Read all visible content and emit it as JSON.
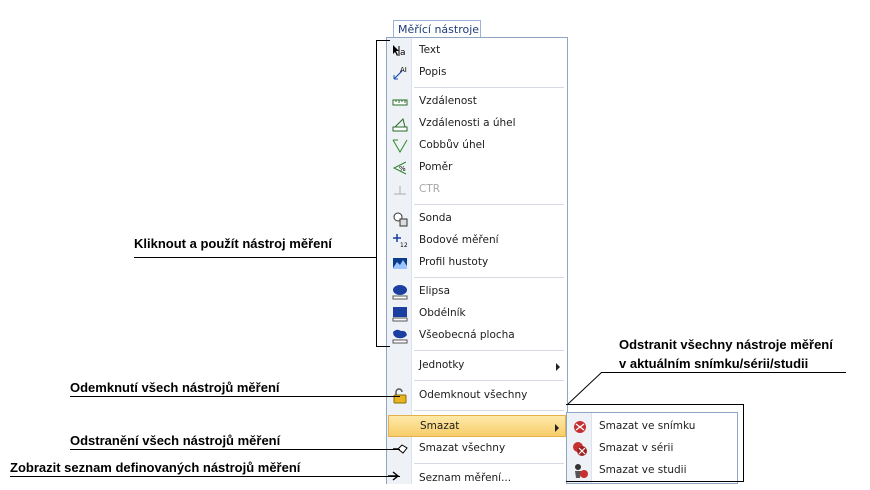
{
  "menu_title": "Měřící nástroje",
  "menu_items": [
    {
      "label": "Text",
      "icon": "text-annotation-icon"
    },
    {
      "label": "Popis",
      "icon": "label-annotation-icon"
    },
    {
      "label": "Vzdálenost",
      "icon": "ruler-icon"
    },
    {
      "label": "Vzdálenosti a úhel",
      "icon": "distance-angle-icon"
    },
    {
      "label": "Cobbův úhel",
      "icon": "cobb-angle-icon"
    },
    {
      "label": "Poměr",
      "icon": "ratio-icon"
    },
    {
      "label": "CTR",
      "icon": "ctr-icon"
    },
    {
      "label": "Sonda",
      "icon": "probe-icon"
    },
    {
      "label": "Bodové měření",
      "icon": "point-measure-icon"
    },
    {
      "label": "Profil hustoty",
      "icon": "density-profile-icon"
    },
    {
      "label": "Elipsa",
      "icon": "ellipse-icon"
    },
    {
      "label": "Obdélník",
      "icon": "rectangle-icon"
    },
    {
      "label": "Všeobecná plocha",
      "icon": "freehand-area-icon"
    },
    {
      "label": "Jednotky",
      "icon": ""
    },
    {
      "label": "Odemknout všechny",
      "icon": "unlock-icon"
    },
    {
      "label": "Smazat",
      "icon": ""
    },
    {
      "label": "Smazat všechny",
      "icon": "eraser-icon"
    },
    {
      "label": "Seznam měření...",
      "icon": "arrow-right-icon"
    }
  ],
  "submenu_items": [
    {
      "label": "Smazat ve snímku",
      "icon": "delete-image-icon"
    },
    {
      "label": "Smazat v sérii",
      "icon": "delete-series-icon"
    },
    {
      "label": "Smazat ve studii",
      "icon": "delete-study-icon"
    }
  ],
  "callouts": {
    "click_use": "Kliknout a použít nástroj měření",
    "unlock": "Odemknutí všech nástrojů měření",
    "delete_all": "Odstranění všech nástrojů měření",
    "list": "Zobrazit seznam definovaných nástrojů měření",
    "remove_line1": "Odstranit všechny nástroje měření",
    "remove_line2": "v aktuálním snímku/sérii/studii"
  },
  "colors": {
    "highlight": "#f8cd6a",
    "menu_border": "#8fa5c4",
    "gutter": "#eef1f6"
  }
}
